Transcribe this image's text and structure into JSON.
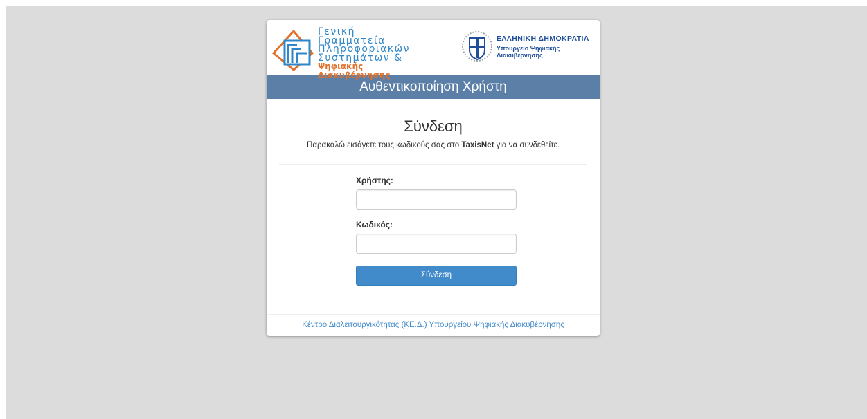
{
  "header": {
    "gsis_lines": [
      "Γενική Γραμματεία",
      "Πληροφοριακών",
      "Συστημάτων &"
    ],
    "gsis_orange_line": "Ψηφιακής Διακυβέρνησης",
    "gsis_mark": "ΓΓ",
    "gr_title": "ΕΛΛΗΝΙΚΗ ΔΗΜΟΚΡΑΤΙΑ",
    "gr_sub_lines": [
      "Υπουργείο Ψηφιακής",
      "Διακυβέρνησης"
    ]
  },
  "banner": {
    "title": "Αυθεντικοποίηση Χρήστη"
  },
  "login": {
    "heading": "Σύνδεση",
    "instruction_before": "Παρακαλώ εισάγετε τους κωδικούς σας στο ",
    "instruction_bold": "TaxisNet",
    "instruction_after": " για να συνδεθείτε.",
    "username_label": "Χρήστης:",
    "username_value": "",
    "password_label": "Κωδικός:",
    "password_value": "",
    "submit_label": "Σύνδεση"
  },
  "footer": {
    "link_text": "Κέντρο Διαλειτουργικότητας (ΚΕ.Δ.) Υπουργείου Ψηφιακής Διακυβέρνησης"
  },
  "colors": {
    "background": "#dcdcdc",
    "banner": "#5b7fa6",
    "button": "#428bca",
    "gsis_blue": "#2f86c8",
    "gsis_orange": "#e0722c",
    "gr_blue": "#1f4e9b"
  }
}
